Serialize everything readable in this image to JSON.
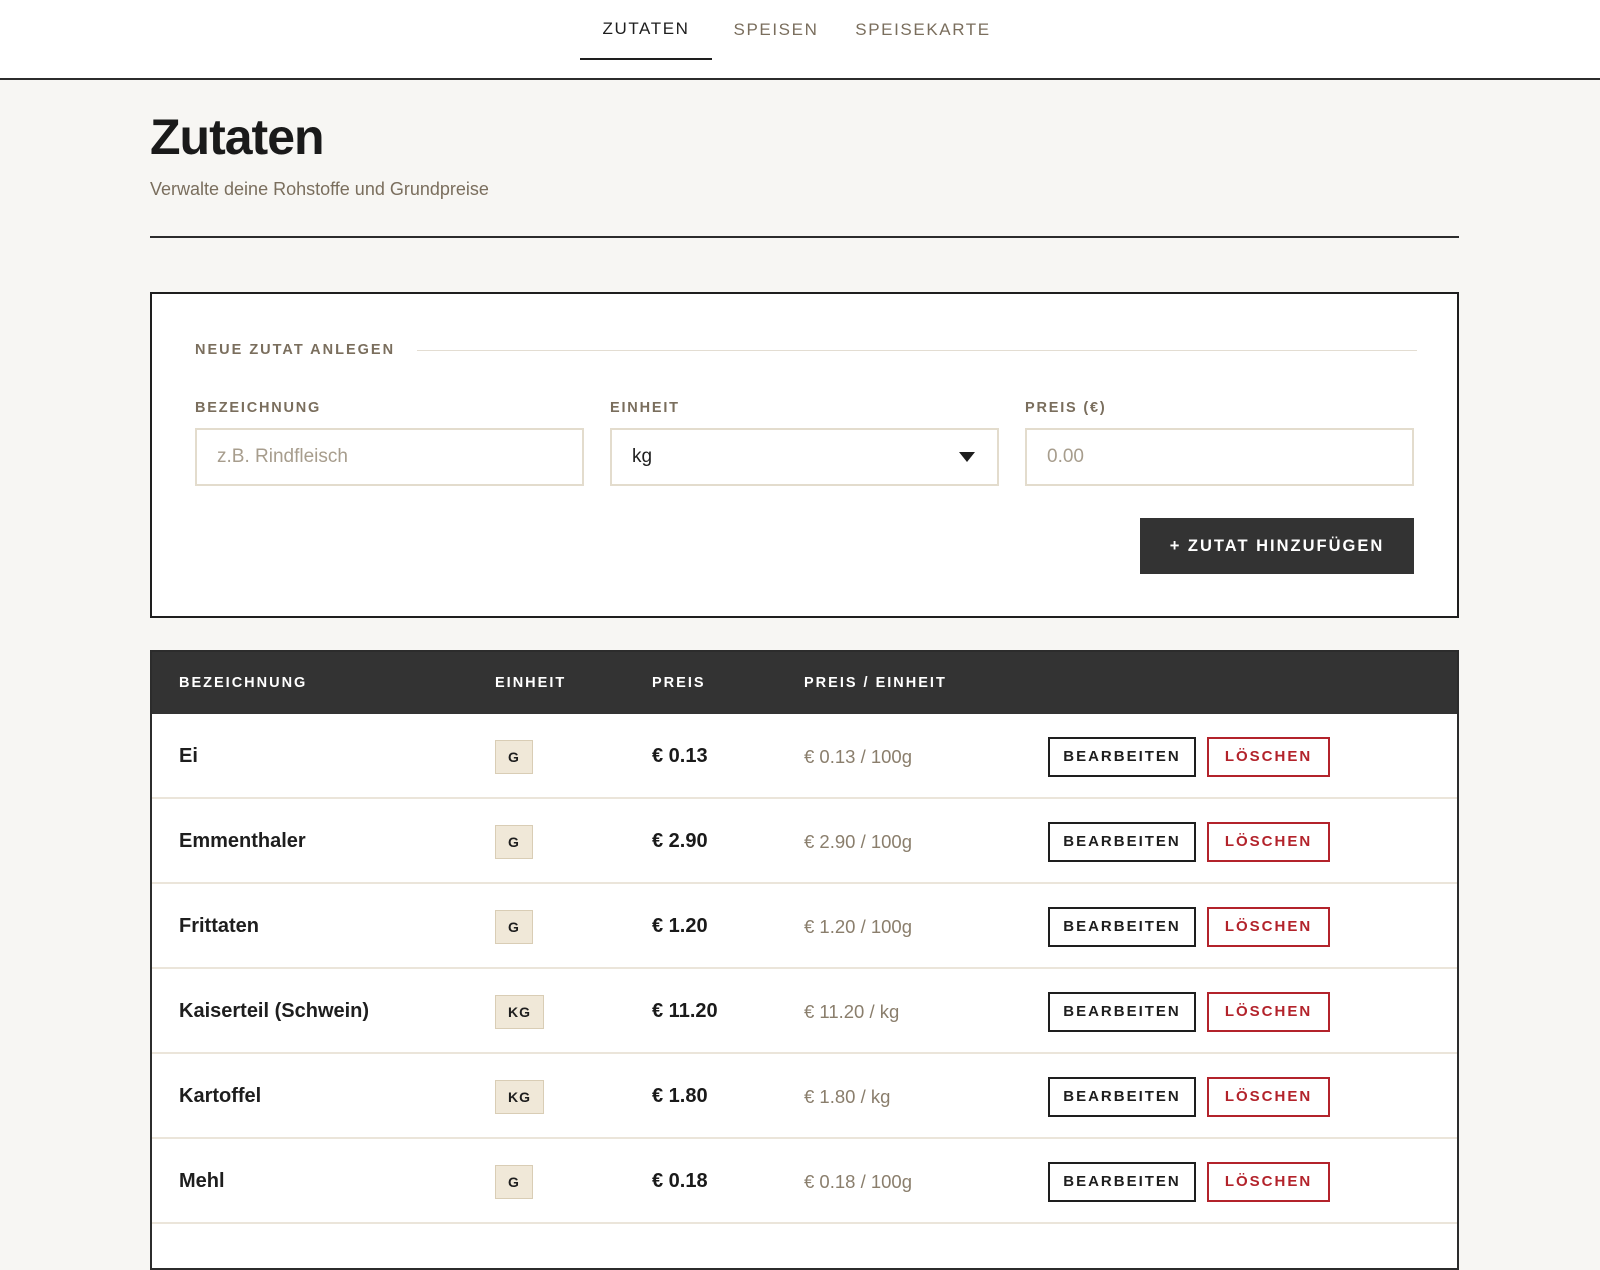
{
  "nav": {
    "tabs": [
      {
        "label": "ZUTATEN",
        "active": true
      },
      {
        "label": "SPEISEN",
        "active": false
      },
      {
        "label": "SPEISEKARTE",
        "active": false
      }
    ]
  },
  "header": {
    "title": "Zutaten",
    "subtitle": "Verwalte deine Rohstoffe und Grundpreise"
  },
  "form": {
    "legend": "NEUE ZUTAT ANLEGEN",
    "name_label": "BEZEICHNUNG",
    "name_placeholder": "z.B. Rindfleisch",
    "name_value": "",
    "unit_label": "EINHEIT",
    "unit_value": "kg",
    "price_label": "PREIS (€)",
    "price_placeholder": "0.00",
    "price_value": "",
    "add_button": "+ ZUTAT HINZUFÜGEN"
  },
  "table": {
    "headers": [
      "BEZEICHNUNG",
      "EINHEIT",
      "PREIS",
      "PREIS / EINHEIT"
    ],
    "edit_label": "BEARBEITEN",
    "delete_label": "LÖSCHEN",
    "rows": [
      {
        "name": "Ei",
        "unit": "G",
        "price": "€ 0.13",
        "price_per_unit": "€ 0.13 / 100g"
      },
      {
        "name": "Emmenthaler",
        "unit": "G",
        "price": "€ 2.90",
        "price_per_unit": "€ 2.90 / 100g"
      },
      {
        "name": "Frittaten",
        "unit": "G",
        "price": "€ 1.20",
        "price_per_unit": "€ 1.20 / 100g"
      },
      {
        "name": "Kaiserteil (Schwein)",
        "unit": "KG",
        "price": "€ 11.20",
        "price_per_unit": "€ 11.20 / kg"
      },
      {
        "name": "Kartoffel",
        "unit": "KG",
        "price": "€ 1.80",
        "price_per_unit": "€ 1.80 / kg"
      },
      {
        "name": "Mehl",
        "unit": "G",
        "price": "€ 0.18",
        "price_per_unit": "€ 0.18 / 100g"
      }
    ]
  },
  "colors": {
    "accent_dark": "#333333",
    "muted_text": "#7a6e5d",
    "danger": "#b3232b",
    "badge_bg": "#f0e8d8",
    "page_bg": "#f7f6f3"
  },
  "icons": {
    "select_arrow": "chevron-down-icon"
  }
}
